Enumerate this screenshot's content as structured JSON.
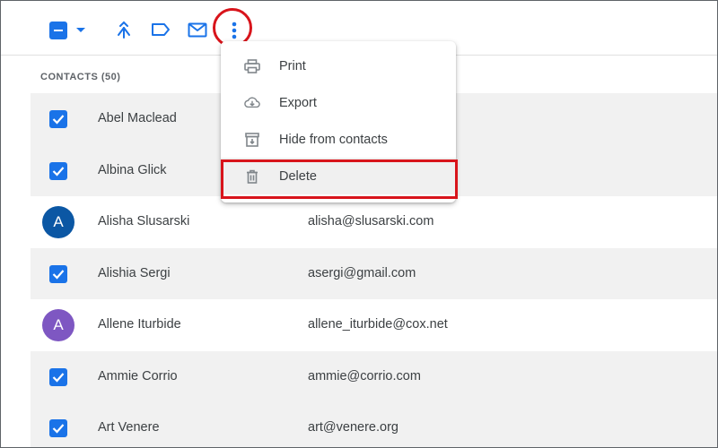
{
  "colors": {
    "accent": "#1a73e8",
    "highlight": "#d8141b",
    "avatar_blue": "#0b57a4",
    "avatar_purple": "#7e57c2"
  },
  "toolbar": {
    "icons": [
      "select-all-checkbox",
      "chevron-down-icon",
      "merge-icon",
      "label-icon",
      "mail-icon",
      "more-vert-icon"
    ]
  },
  "contacts": {
    "header": "CONTACTS (50)",
    "rows": [
      {
        "name": "Abel Maclead",
        "email": "",
        "selected": true
      },
      {
        "name": "Albina Glick",
        "email": "",
        "selected": true
      },
      {
        "name": "Alisha Slusarski",
        "email": "alisha@slusarski.com",
        "selected": false,
        "avatar": "A"
      },
      {
        "name": "Alishia Sergi",
        "email": "asergi@gmail.com",
        "selected": true
      },
      {
        "name": "Allene Iturbide",
        "email": "allene_iturbide@cox.net",
        "selected": false,
        "avatar": "A"
      },
      {
        "name": "Ammie Corrio",
        "email": "ammie@corrio.com",
        "selected": true
      },
      {
        "name": "Art Venere",
        "email": "art@venere.org",
        "selected": true
      }
    ]
  },
  "menu": {
    "items": [
      {
        "label": "Print",
        "icon": "print-icon"
      },
      {
        "label": "Export",
        "icon": "cloud-download-icon"
      },
      {
        "label": "Hide from contacts",
        "icon": "archive-icon"
      },
      {
        "label": "Delete",
        "icon": "trash-icon"
      }
    ]
  }
}
